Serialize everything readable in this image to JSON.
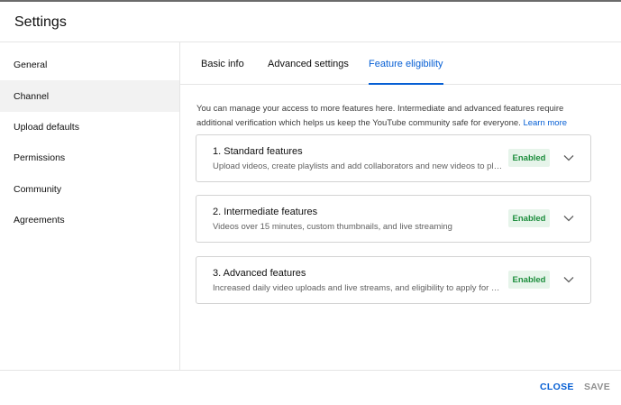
{
  "dialog": {
    "title": "Settings"
  },
  "sidebar": {
    "items": [
      {
        "label": "General"
      },
      {
        "label": "Channel"
      },
      {
        "label": "Upload defaults"
      },
      {
        "label": "Permissions"
      },
      {
        "label": "Community"
      },
      {
        "label": "Agreements"
      }
    ],
    "active_index": 1
  },
  "tabs": {
    "items": [
      {
        "label": "Basic info"
      },
      {
        "label": "Advanced settings"
      },
      {
        "label": "Feature eligibility"
      }
    ],
    "active_index": 2
  },
  "main": {
    "intro": "You can manage your access to more features here. Intermediate and advanced features require additional verification which helps us keep the YouTube community safe for everyone.",
    "learn_more": "Learn more",
    "features": [
      {
        "title": "1. Standard features",
        "description": "Upload videos, create playlists and add collaborators and new videos to playlists",
        "status": "Enabled"
      },
      {
        "title": "2. Intermediate features",
        "description": "Videos over 15 minutes, custom thumbnails, and live streaming",
        "status": "Enabled"
      },
      {
        "title": "3. Advanced features",
        "description": "Increased daily video uploads and live streams, and eligibility to apply for monetization",
        "status": "Enabled"
      }
    ]
  },
  "footer": {
    "close_label": "CLOSE",
    "save_label": "SAVE"
  },
  "colors": {
    "accent": "#065fd4",
    "enabled_bg": "#e6f4ea",
    "enabled_text": "#1e8e3e",
    "active_sidebar_bg": "#f2f2f2"
  },
  "icons": {
    "expand": "chevron-down-icon"
  }
}
